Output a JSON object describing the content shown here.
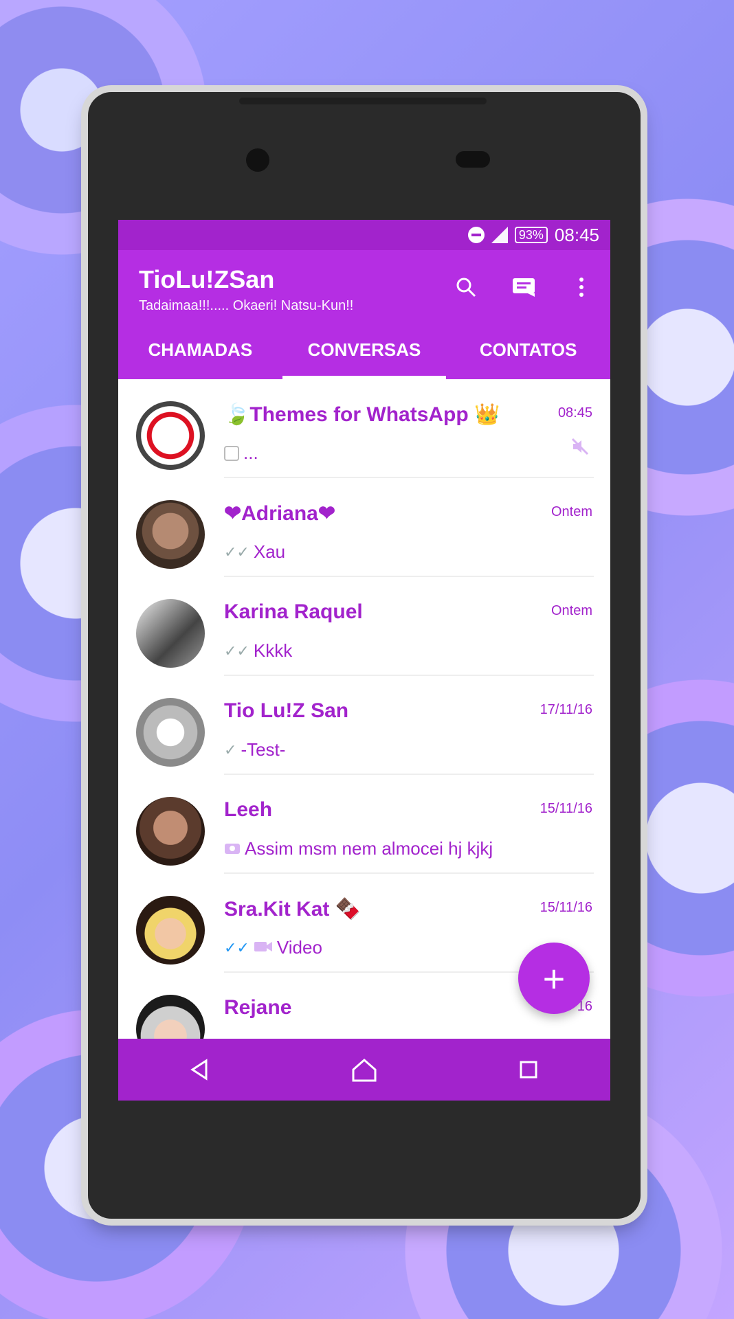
{
  "status": {
    "battery": "93%",
    "time": "08:45"
  },
  "appbar": {
    "title": "TioLu!ZSan",
    "subtitle": "Tadaimaa!!!..... Okaeri! Natsu-Kun!!",
    "icons": [
      "search-icon",
      "new-chat-icon",
      "more-options-icon"
    ]
  },
  "tabs": [
    {
      "label": "CHAMADAS"
    },
    {
      "label": "CONVERSAS"
    },
    {
      "label": "CONTATOS"
    }
  ],
  "chats": [
    {
      "name": "🍃Themes for WhatsApp 👑",
      "time": "08:45",
      "message": "...",
      "status": "clock",
      "muted": true
    },
    {
      "name": "❤Adriana❤",
      "time": "Ontem",
      "message": "Xau",
      "status": "double-check-gray"
    },
    {
      "name": "Karina Raquel",
      "time": "Ontem",
      "message": "Kkkk",
      "status": "double-check-gray"
    },
    {
      "name": "Tio Lu!Z San",
      "time": "17/11/16",
      "message": "-Test-",
      "status": "single-check-gray"
    },
    {
      "name": "Leeh",
      "time": "15/11/16",
      "message": "Assim msm nem almocei hj kjkj",
      "status": "camera"
    },
    {
      "name": "Sra.Kit Kat 🍫",
      "time": "15/11/16",
      "message": "Video",
      "status": "double-check-blue-video"
    },
    {
      "name": "Rejane",
      "time": "16",
      "message": "",
      "status": ""
    }
  ],
  "fab": {
    "label": "+"
  },
  "colors": {
    "primary": "#b52ee3",
    "primary_dark": "#a223cc"
  }
}
